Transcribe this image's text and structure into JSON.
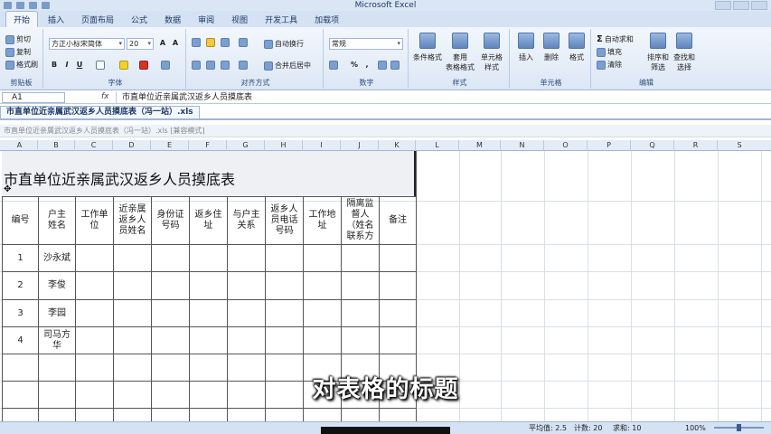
{
  "app": {
    "title": "Microsoft Excel"
  },
  "ribbon_tabs": [
    "开始",
    "插入",
    "页面布局",
    "公式",
    "数据",
    "审阅",
    "视图",
    "开发工具",
    "加载项"
  ],
  "clipboard": {
    "cut": "剪切",
    "copy": "复制",
    "format_painter": "格式刷",
    "label": "剪贴板"
  },
  "font": {
    "name": "方正小标宋简体",
    "size": "20",
    "bold": "B",
    "italic": "I",
    "underline": "U",
    "label": "字体"
  },
  "alignment": {
    "wrap": "自动换行",
    "merge": "合并后居中",
    "label": "对齐方式"
  },
  "number": {
    "format": "常规",
    "percent": "%",
    "comma": ",",
    "label": "数字"
  },
  "styles": {
    "conditional": "条件格式",
    "table": "套用\n表格格式",
    "cell": "单元格\n样式",
    "label": "样式"
  },
  "cells": {
    "insert": "插入",
    "delete": "删除",
    "format": "格式",
    "label": "单元格"
  },
  "editing": {
    "autosum": "自动求和",
    "fill": "填充",
    "clear": "清除",
    "sort": "排序和\n筛选",
    "find": "查找和\n选择",
    "label": "编辑"
  },
  "formula_bar": {
    "name_box": "A1",
    "fx": "fx",
    "content": "市直单位近亲属武汉返乡人员摸底表"
  },
  "document": {
    "tab": "市直单位近亲属武汉返乡人员摸底表（冯一站）.xls",
    "window_title": "市直单位近亲属武汉返乡人员摸底表（冯一站）.xls  [兼容模式]"
  },
  "columns": [
    "A",
    "B",
    "C",
    "D",
    "E",
    "F",
    "G",
    "H",
    "I",
    "J",
    "K",
    "L",
    "M",
    "N",
    "O",
    "P",
    "Q",
    "R",
    "S"
  ],
  "sheet": {
    "title": "市直单位近亲属武汉返乡人员摸底表",
    "headers": [
      "编号",
      "户主姓名",
      "工作单位",
      "近亲属返乡人员姓名",
      "身份证号码",
      "返乡住址",
      "与户主关系",
      "返乡人员电话号码",
      "工作地址",
      "隔离监督人（姓名联系方",
      "备注"
    ],
    "rows": [
      {
        "no": "1",
        "name": "沙永斌"
      },
      {
        "no": "2",
        "name": "李俊"
      },
      {
        "no": "3",
        "name": "李园"
      },
      {
        "no": "4",
        "name": "司马方华"
      }
    ]
  },
  "subtitle": "对表格的标题",
  "status": {
    "average": "平均值: 2.5",
    "count": "计数: 20",
    "sum": "求和: 10",
    "zoom": "100%"
  }
}
